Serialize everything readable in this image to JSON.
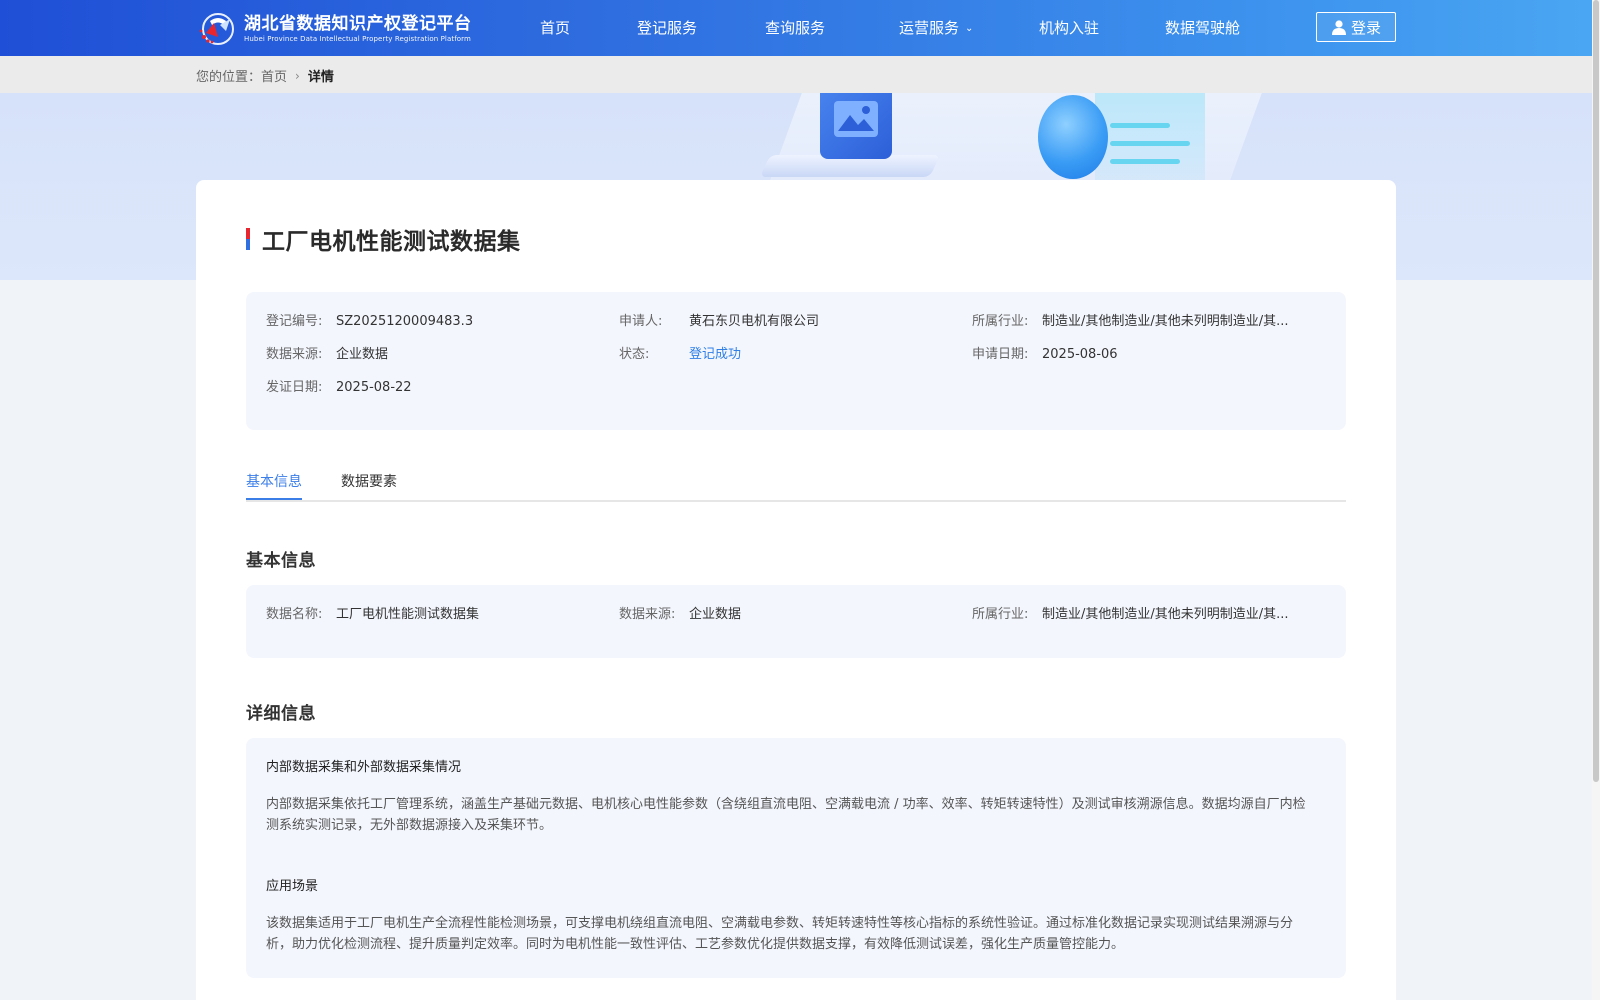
{
  "header": {
    "logo_cn": "湖北省数据知识产权登记平台",
    "logo_en": "Hubei Province Data Intellectual Property Registration Platform",
    "nav": [
      {
        "label": "首页"
      },
      {
        "label": "登记服务"
      },
      {
        "label": "查询服务"
      },
      {
        "label": "运营服务"
      },
      {
        "label": "机构入驻"
      },
      {
        "label": "数据驾驶舱"
      }
    ],
    "login_label": "登录"
  },
  "breadcrumb": {
    "prefix": "您的位置：",
    "home": "首页",
    "current": "详情"
  },
  "detail": {
    "title": "工厂电机性能测试数据集",
    "summary": {
      "reg_no_label": "登记编号:",
      "reg_no": "SZ2025120009483.3",
      "applicant_label": "申请人:",
      "applicant": "黄石东贝电机有限公司",
      "industry_label": "所属行业:",
      "industry": "制造业/其他制造业/其他未列明制造业/其...",
      "source_label": "数据来源:",
      "source": "企业数据",
      "status_label": "状态:",
      "status": "登记成功",
      "apply_date_label": "申请日期:",
      "apply_date": "2025-08-06",
      "cert_date_label": "发证日期:",
      "cert_date": "2025-08-22"
    },
    "tabs": [
      {
        "label": "基本信息",
        "active": true
      },
      {
        "label": "数据要素",
        "active": false
      }
    ],
    "basic_section_title": "基本信息",
    "basic": {
      "name_label": "数据名称:",
      "name": "工厂电机性能测试数据集",
      "source_label": "数据来源:",
      "source": "企业数据",
      "industry_label": "所属行业:",
      "industry": "制造业/其他制造业/其他未列明制造业/其..."
    },
    "detail_section_title": "详细信息",
    "detail_items": [
      {
        "heading": "内部数据采集和外部数据采集情况",
        "text": "内部数据采集依托工厂管理系统，涵盖生产基础元数据、电机核心电性能参数（含绕组直流电阻、空满载电流 / 功率、效率、转矩转速特性）及测试审核溯源信息。数据均源自厂内检测系统实测记录，无外部数据源接入及采集环节。"
      },
      {
        "heading": "应用场景",
        "text": "该数据集适用于工厂电机生产全流程性能检测场景，可支撑电机绕组直流电阻、空满载电参数、转矩转速特性等核心指标的系统性验证。通过标准化数据记录实现测试结果溯源与分析，助力优化检测流程、提升质量判定效率。同时为电机性能一致性评估、工艺参数优化提供数据支撑，有效降低测试误差，强化生产质量管控能力。"
      }
    ]
  },
  "colors": {
    "header_start": "#1f4fd6",
    "header_end": "#4aa6f2",
    "accent": "#3b7ee8",
    "status_success": "#2f7fe6",
    "panel_bg": "#f3f6fd"
  }
}
